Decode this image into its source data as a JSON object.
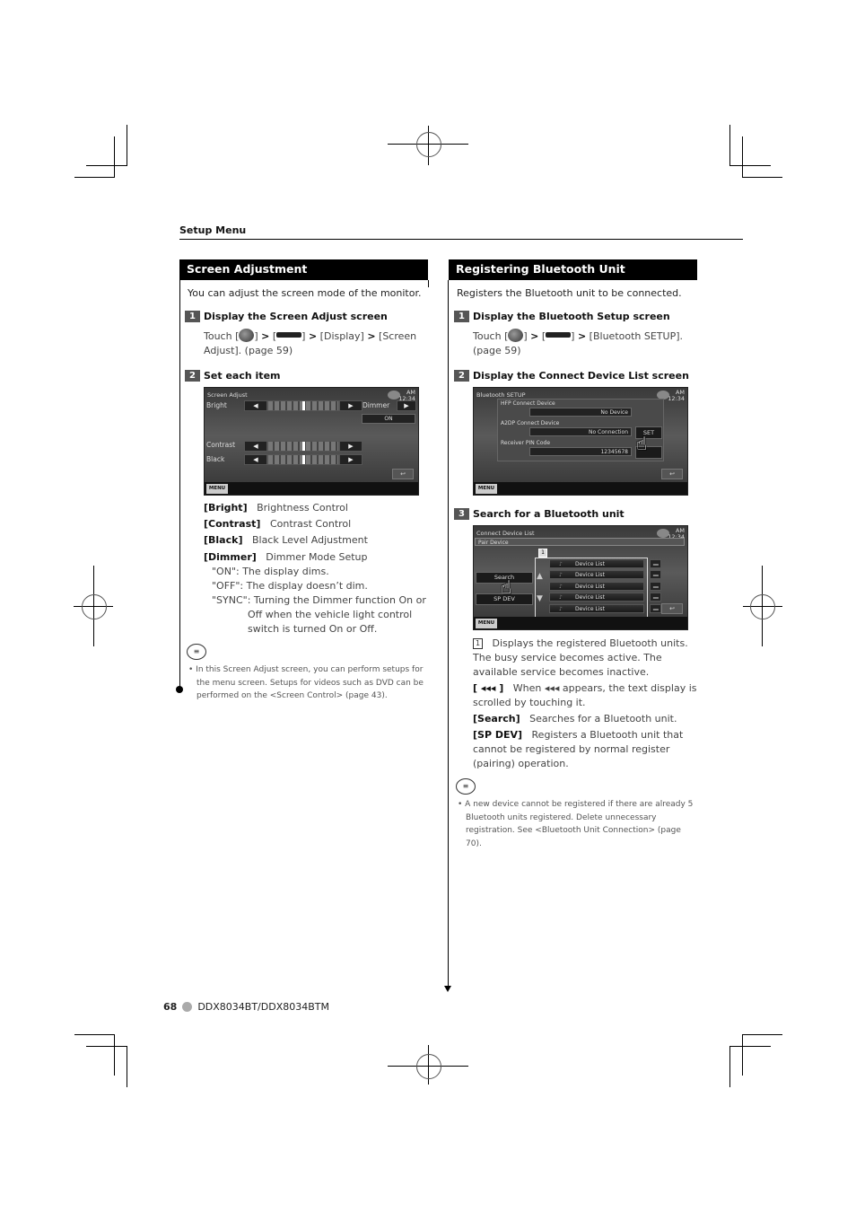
{
  "header": {
    "section": "Setup Menu"
  },
  "left": {
    "title": "Screen Adjustment",
    "intro": "You can adjust the screen mode of the monitor.",
    "steps": [
      {
        "num": "1",
        "label": "Display the Screen Adjust screen",
        "touch_prefix": "Touch [",
        "touch_mid1": "] ",
        "gt": ">",
        "touch_mid2": " [",
        "touch_mid3": "] ",
        "touch_rest": " [Display] ",
        "touch_rest2": " [Screen Adjust]. (page 59)"
      },
      {
        "num": "2",
        "label": "Set each item"
      }
    ],
    "screen": {
      "title": "Screen Adjust",
      "clock_ampm": "AM",
      "clock_time": "12:34",
      "rows": [
        {
          "label": "Bright",
          "level": 0.5
        },
        {
          "label": "Contrast",
          "level": 0.5
        },
        {
          "label": "Black",
          "level": 0.5
        }
      ],
      "dimmer_label": "Dimmer",
      "dimmer_value": "ON",
      "left_arrow": "◀",
      "right_arrow": "▶",
      "back": "↩",
      "menu": "MENU"
    },
    "descriptions": [
      {
        "key": "[Bright]",
        "text": "Brightness Control"
      },
      {
        "key": "[Contrast]",
        "text": "Contrast Control"
      },
      {
        "key": "[Black]",
        "text": "Black Level Adjustment"
      },
      {
        "key": "[Dimmer]",
        "text": "Dimmer Mode Setup"
      }
    ],
    "dimmer_options": [
      "\"ON\": The display dims.",
      "\"OFF\": The display doesn’t dim.",
      "\"SYNC\": Turning the Dimmer function On or"
    ],
    "dimmer_sync_cont": "Off when the vehicle light control switch is turned On or Off.",
    "note_icon": "memo-icon",
    "note": "In this Screen Adjust screen, you can perform setups for the menu screen. Setups for videos such as DVD can be performed on the <Screen Control> (page 43)."
  },
  "right": {
    "title": "Registering Bluetooth Unit",
    "intro": "Registers the Bluetooth unit to be connected.",
    "steps": [
      {
        "num": "1",
        "label": "Display the Bluetooth Setup screen",
        "touch_prefix": "Touch [",
        "touch_mid1": "] ",
        "gt": ">",
        "touch_mid2": " [",
        "touch_mid3": "] ",
        "touch_rest": " [Bluetooth SETUP]. (page 59)"
      },
      {
        "num": "2",
        "label": "Display the Connect Device List screen"
      },
      {
        "num": "3",
        "label": "Search for a Bluetooth unit"
      }
    ],
    "bt_screen": {
      "title": "Bluetooth SETUP",
      "clock_ampm": "AM",
      "clock_time": "12:34",
      "hfp_label": "HFP Connect Device",
      "hfp_value": "No Device",
      "a2dp_label": "A2DP Connect Device",
      "a2dp_value": "No Connection",
      "set": "SET",
      "pin_label": "Receiver PIN Code",
      "pin_value": "12345678",
      "back": "↩",
      "menu": "MENU"
    },
    "list_screen": {
      "title": "Connect Device List",
      "clock_ampm": "AM",
      "clock_time": "12:34",
      "tab": "Pair Device",
      "callout": "1",
      "search": "Search",
      "spdev": "SP DEV",
      "up": "▲",
      "down": "▼",
      "items": [
        "Device List",
        "Device List",
        "Device List",
        "Device List",
        "Device List"
      ],
      "scroll": "◂◂◂",
      "back": "↩",
      "menu": "MENU"
    },
    "desc_callout": "1",
    "desc_callout_text": "Displays the registered Bluetooth units. The busy service becomes active. The available service becomes inactive.",
    "desc_scroll_key": "[ ◂◂◂ ]",
    "desc_scroll_text": "When ◂◂◂ appears, the text display is scrolled by touching it.",
    "desc_search_key": "[Search]",
    "desc_search_text": "Searches for a Bluetooth unit.",
    "desc_spdev_key": "[SP DEV]",
    "desc_spdev_text": "Registers a Bluetooth unit that cannot be registered by normal register (pairing) operation.",
    "note_icon": "memo-icon",
    "note": "A new device cannot be registered if there are already 5 Bluetooth units registered. Delete unnecessary registration. See <Bluetooth Unit Connection> (page 70)."
  },
  "footer": {
    "page": "68",
    "model": "DDX8034BT/DDX8034BTM"
  }
}
